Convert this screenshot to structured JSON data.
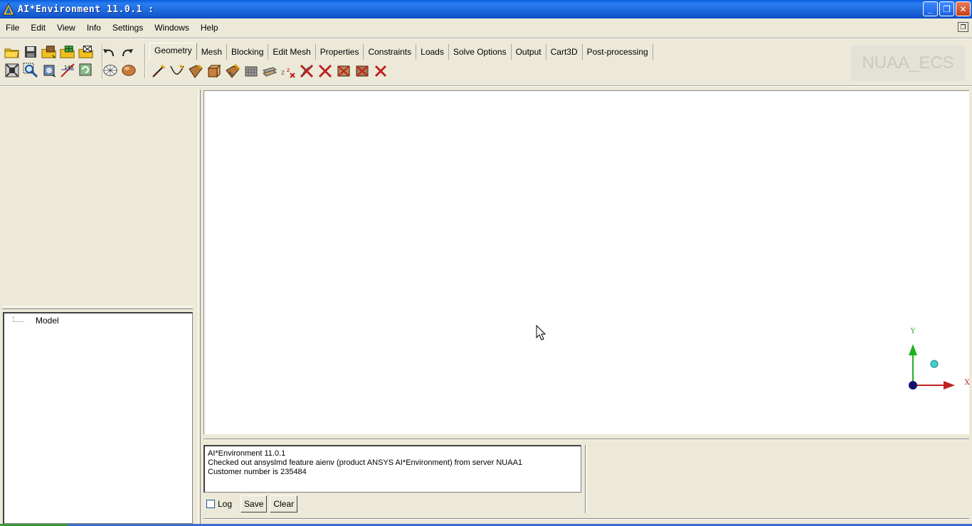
{
  "window": {
    "title": "AI*Environment 11.0.1 :",
    "controls": {
      "minimize": "_",
      "restore": "❐",
      "close": "✕"
    }
  },
  "menu": {
    "items": [
      "File",
      "Edit",
      "View",
      "Info",
      "Settings",
      "Windows",
      "Help"
    ]
  },
  "toolbar": {
    "row1_icons": [
      "open-folder-icon",
      "save-icon",
      "open-geometry-icon",
      "open-mesh-icon",
      "open-blocking-icon",
      "undo-icon",
      "redo-icon"
    ],
    "row2_icons": [
      "fit-window-icon",
      "zoom-box-icon",
      "measure-icon",
      "distance-icon",
      "refresh-icon",
      "wireframe-icon",
      "shaded-icon"
    ]
  },
  "tabs": {
    "items": [
      "Geometry",
      "Mesh",
      "Blocking",
      "Edit Mesh",
      "Properties",
      "Constraints",
      "Loads",
      "Solve Options",
      "Output",
      "Cart3D",
      "Post-processing"
    ],
    "active_index": 0
  },
  "geometry_tools": [
    "create-point-icon",
    "create-curve-icon",
    "create-surface-icon",
    "create-body-icon",
    "repair-geometry-icon",
    "transform-icon",
    "restore-icon",
    "delete-point-icon",
    "delete-curve-icon",
    "delete-surface-icon",
    "delete-body-icon",
    "delete-any-icon"
  ],
  "watermark": "NUAA_ECS",
  "tree": {
    "root_label": "Model"
  },
  "axes": {
    "x_label": "X",
    "y_label": "Y"
  },
  "messages": {
    "lines": [
      "AI*Environment 11.0.1",
      "Checked out ansyslmd feature aienv (product ANSYS AI*Environment) from server NUAA1",
      "Customer number is 235484"
    ],
    "log_label": "Log",
    "save_label": "Save",
    "clear_label": "Clear"
  }
}
